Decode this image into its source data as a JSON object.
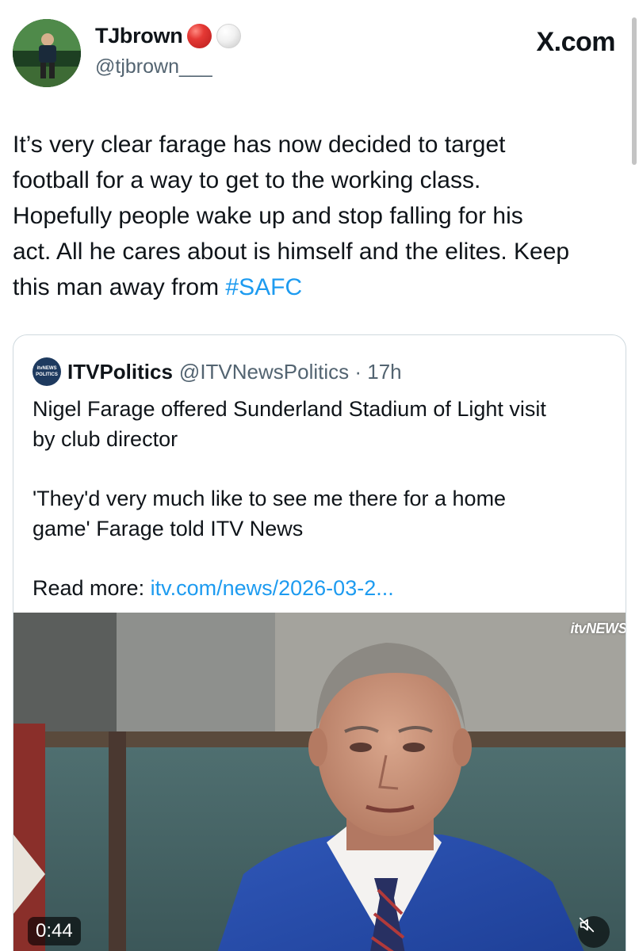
{
  "header": {
    "display_name": "TJbrown",
    "handle": "@tjbrown___",
    "site_label": "X.com"
  },
  "tweet": {
    "lines": [
      "It’s very clear farage has now decided to target",
      "football for a way to get to the working class.",
      "Hopefully people wake up and stop falling for his",
      "act. All he cares about is himself and the elites. Keep",
      "this man away from "
    ],
    "hashtag": "#SAFC"
  },
  "quoted_post": {
    "logo_text_1": "itvNEWS",
    "logo_text_2": "POLITICS",
    "display_name": "ITVPolitics",
    "handle_time": "@ITVNewsPolitics · 17h",
    "headline_lines": [
      "Nigel Farage offered Sunderland Stadium of Light visit",
      "by club director"
    ],
    "quote_lines": [
      "'They'd very much like to see me there for a home",
      "game' Farage told ITV News"
    ],
    "read_more_label": "Read more: ",
    "read_more_link": "itv.com/news/2026-03-2...",
    "video": {
      "watermark": "itvNEWS",
      "duration": "0:44"
    }
  },
  "colors": {
    "link": "#1d9bf0",
    "text": "#0f1419",
    "muted": "#536471",
    "border": "#cfd9de"
  }
}
